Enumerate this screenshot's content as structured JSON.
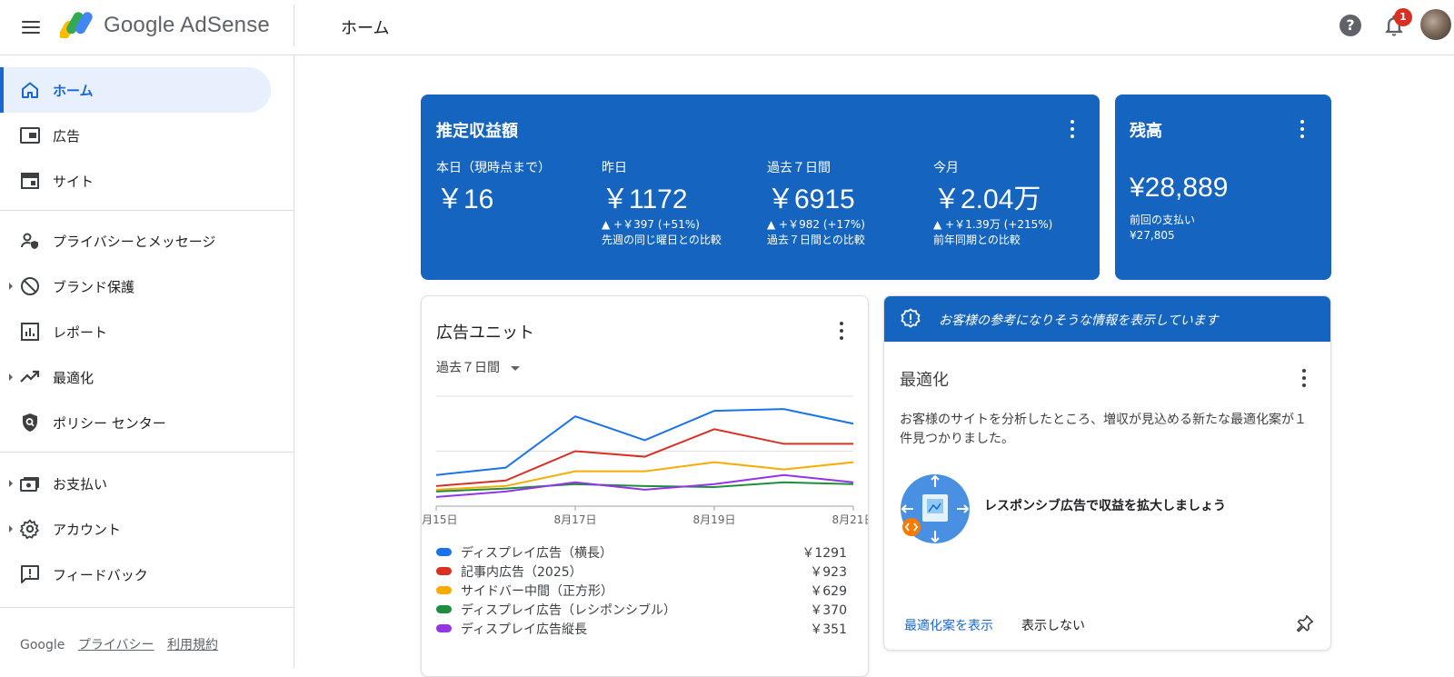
{
  "header": {
    "product_name": "Google AdSense",
    "page_title": "ホーム",
    "notification_count": "1",
    "help_label": "?"
  },
  "sidebar": {
    "items": [
      {
        "label": "ホーム",
        "icon": "home-icon",
        "active": true
      },
      {
        "label": "広告",
        "icon": "ads-icon"
      },
      {
        "label": "サイト",
        "icon": "sites-icon"
      },
      {
        "label": "プライバシーとメッセージ",
        "icon": "privacy-icon"
      },
      {
        "label": "ブランド保護",
        "icon": "block-icon",
        "expandable": true
      },
      {
        "label": "レポート",
        "icon": "reports-icon"
      },
      {
        "label": "最適化",
        "icon": "trending-icon",
        "expandable": true
      },
      {
        "label": "ポリシー センター",
        "icon": "policy-shield-icon"
      },
      {
        "label": "お支払い",
        "icon": "payments-icon",
        "expandable": true
      },
      {
        "label": "アカウント",
        "icon": "settings-icon",
        "expandable": true
      },
      {
        "label": "フィードバック",
        "icon": "feedback-icon"
      }
    ],
    "footer": {
      "brand": "Google",
      "privacy": "プライバシー",
      "terms": "利用規約"
    }
  },
  "earnings": {
    "title": "推定収益額",
    "metrics": [
      {
        "label": "本日（現時点まで）",
        "value": "￥16",
        "delta": "",
        "compare": ""
      },
      {
        "label": "昨日",
        "value": "￥1172",
        "delta": "▲ +￥397 (+51%)",
        "compare": "先週の同じ曜日との比較"
      },
      {
        "label": "過去７日間",
        "value": "￥6915",
        "delta": "▲ +￥982 (+17%)",
        "compare": "過去７日間との比較"
      },
      {
        "label": "今月",
        "value": "￥2.04万",
        "delta": "▲ +￥1.39万 (+215%)",
        "compare": "前年同期との比較"
      }
    ]
  },
  "balance": {
    "title": "残高",
    "value": "¥28,889",
    "last_payment_label": "前回の支払い",
    "last_payment_value": "¥27,805"
  },
  "ad_units": {
    "title": "広告ユニット",
    "period": "過去７日間",
    "legend": [
      {
        "name": "ディスプレイ広告（横長）",
        "value": "￥1291",
        "color": "#1a73e8"
      },
      {
        "name": "記事内広告（2025）",
        "value": "￥923",
        "color": "#d93025"
      },
      {
        "name": "サイドバー中間（正方形）",
        "value": "￥629",
        "color": "#f9ab00"
      },
      {
        "name": "ディスプレイ広告（レシポンシブル）",
        "value": "￥370",
        "color": "#1e8e3e"
      },
      {
        "name": "ディスプレイ広告縦長",
        "value": "￥351",
        "color": "#9334e6"
      }
    ]
  },
  "chart_data": {
    "type": "line",
    "x": [
      "8月15日",
      "8月16日",
      "8月17日",
      "8月18日",
      "8月19日",
      "8月20日",
      "8月21日"
    ],
    "x_tick_labels": [
      "8月15日",
      "8月17日",
      "8月19日",
      "8月21日"
    ],
    "ylim": [
      0,
      300
    ],
    "grid": true,
    "series": [
      {
        "name": "ディスプレイ広告（横長）",
        "color": "#1a73e8",
        "values": [
          85,
          105,
          245,
          180,
          260,
          265,
          225
        ]
      },
      {
        "name": "記事内広告（2025）",
        "color": "#d93025",
        "values": [
          55,
          70,
          150,
          135,
          210,
          170,
          170
        ]
      },
      {
        "name": "サイドバー中間（正方形）",
        "color": "#f9ab00",
        "values": [
          45,
          55,
          95,
          95,
          120,
          100,
          120
        ]
      },
      {
        "name": "ディスプレイ広告（レシポンシブル）",
        "color": "#1e8e3e",
        "values": [
          40,
          48,
          60,
          55,
          52,
          65,
          60
        ]
      },
      {
        "name": "ディスプレイ広告縦長",
        "color": "#9334e6",
        "values": [
          25,
          40,
          65,
          45,
          60,
          85,
          65
        ]
      }
    ]
  },
  "optimization": {
    "banner_text": "お客様の参考になりそうな情報を表示しています",
    "title": "最適化",
    "description": "お客様のサイトを分析したところ、増収が見込める新たな最適化案が１件見つかりました。",
    "suggestion": "レスポンシブ広告で収益を拡大しましょう",
    "show_button": "最適化案を表示",
    "dismiss_button": "表示しない"
  },
  "colors": {
    "brand_blue": "#1565c0",
    "link_blue": "#1967d2",
    "active_nav_bg": "#e8f0fe"
  }
}
